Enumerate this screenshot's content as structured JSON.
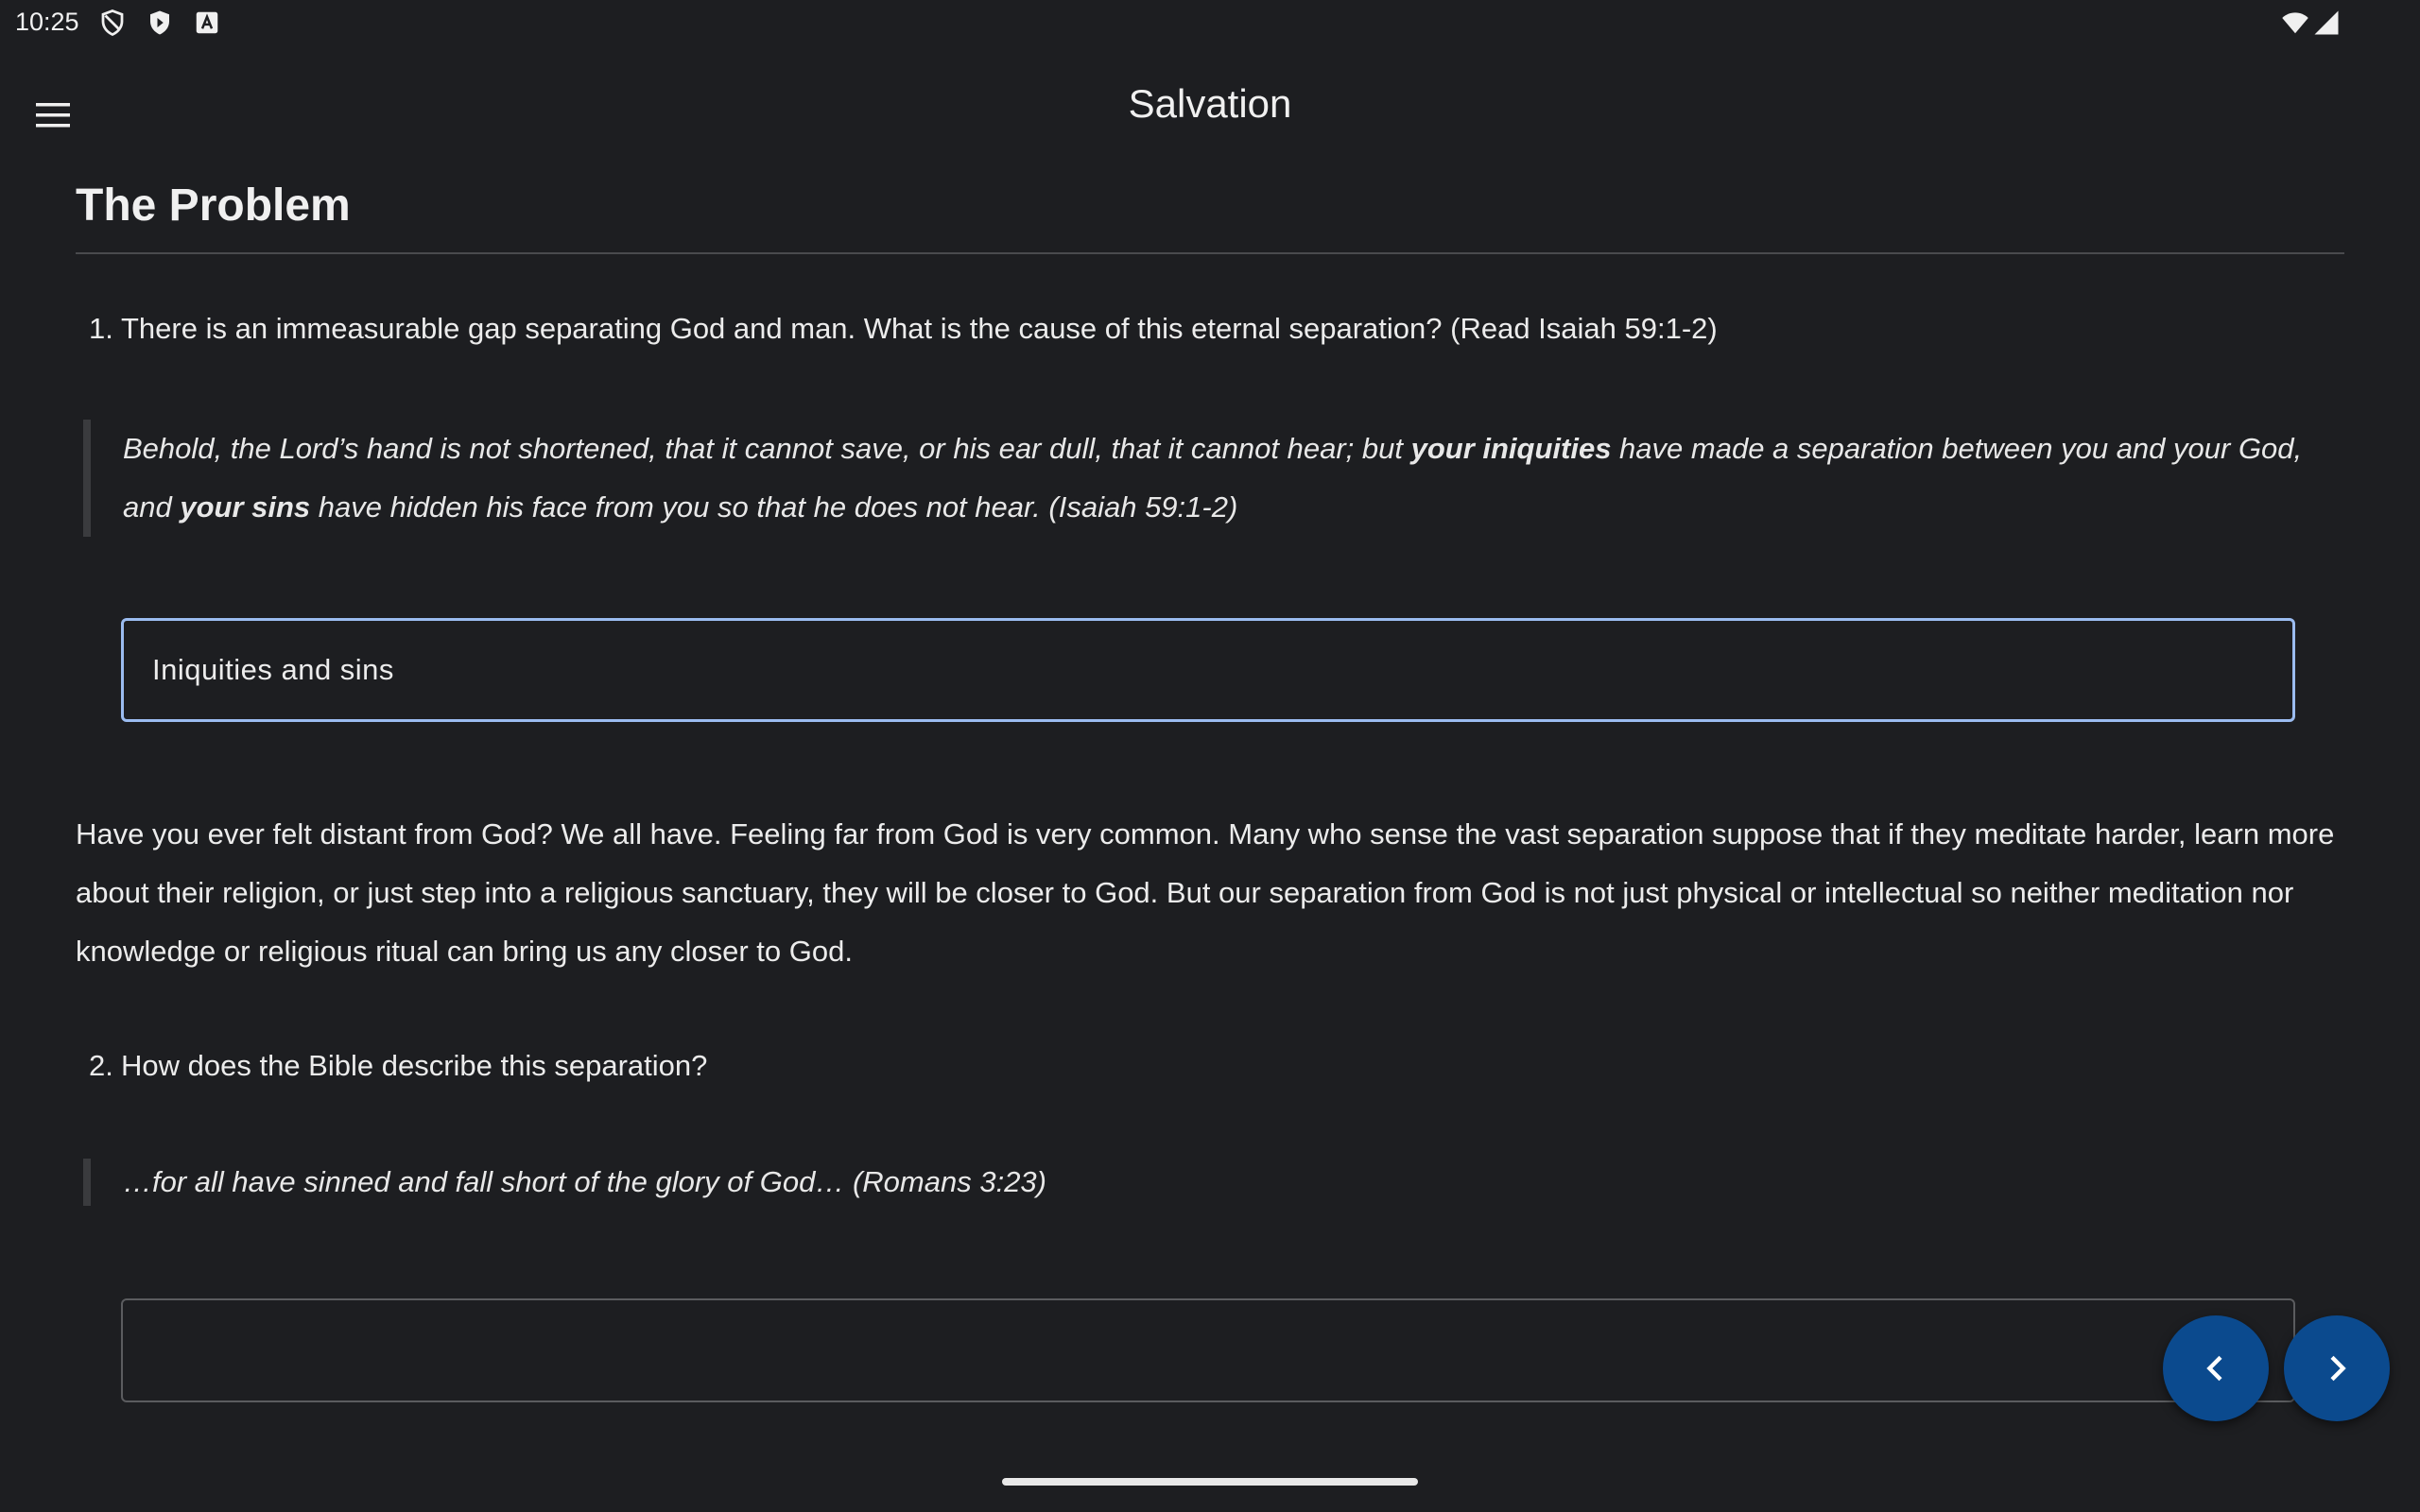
{
  "status_bar": {
    "time": "10:25",
    "icons_left": [
      "shield-outline-icon",
      "play-shield-icon",
      "a-box-icon"
    ],
    "icons_right": [
      "wifi-icon",
      "cellular-signal-icon"
    ]
  },
  "app_bar": {
    "title": "Salvation",
    "menu_icon": "hamburger-menu-icon"
  },
  "content": {
    "heading": "The Problem",
    "q1": {
      "number": "1.",
      "text": "There is an immeasurable gap separating God and man. What is the cause of this eternal separation? (Read Isaiah 59:1-2)"
    },
    "quote1": {
      "part1": "Behold, the Lord’s hand is not shortened, that it cannot save, or his ear dull, that it cannot hear; but ",
      "bold1": "your iniquities",
      "part2": " have made a separation between you and your God, and ",
      "bold2": "your sins",
      "part3": " have hidden his face from you so that he does not hear. (Isaiah 59:1-2)"
    },
    "answer1": {
      "value": "Iniquities and sins",
      "placeholder": ""
    },
    "paragraph1": "Have you ever felt distant from God? We all have. Feeling far from God is very common. Many who sense the vast separation suppose that if they meditate harder, learn more about their religion, or just step into a religious sanctuary, they will be closer to God. But our separation from God is not just physical or intellectual so neither meditation nor knowledge or religious ritual can bring us any closer to God.",
    "q2": {
      "number": "2.",
      "text": "How does the Bible describe this separation?"
    },
    "quote2": {
      "text": "…for all have sinned and fall short of the glory of God… (Romans 3:23)"
    },
    "answer2": {
      "value": "",
      "placeholder": ""
    }
  },
  "navigation": {
    "prev_icon": "chevron-left-icon",
    "next_icon": "chevron-right-icon"
  },
  "colors": {
    "background": "#1d1e21",
    "fab": "#0b4a8e",
    "focus_border": "#9bbcf0"
  }
}
